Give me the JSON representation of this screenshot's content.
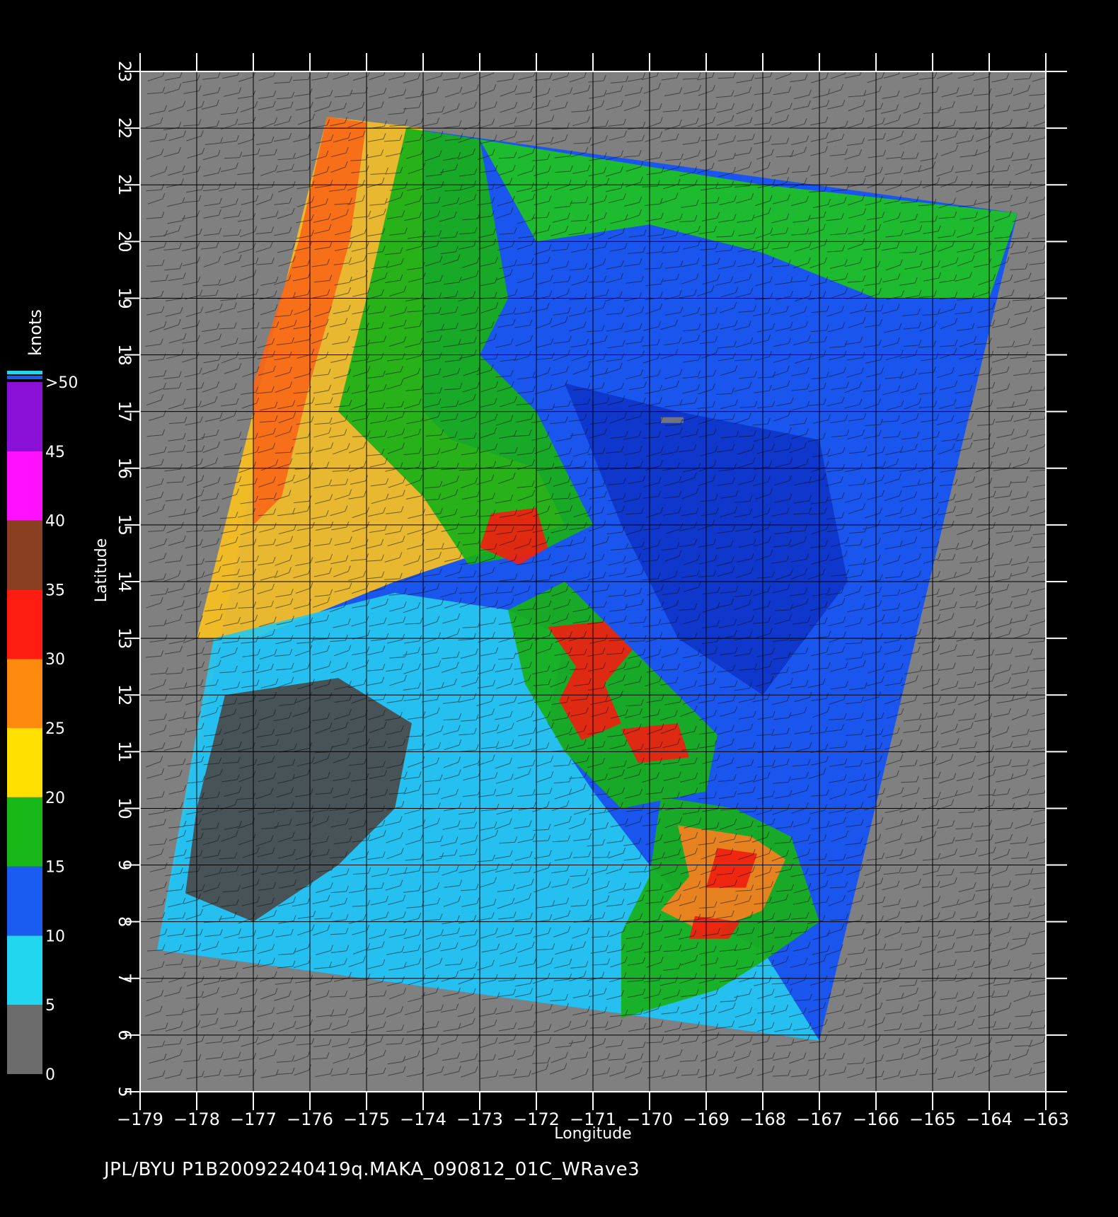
{
  "axes": {
    "xlabel": "Longitude",
    "ylabel": "Latitude",
    "x_ticks": [
      "−179",
      "−178",
      "−177",
      "−176",
      "−175",
      "−174",
      "−173",
      "−172",
      "−171",
      "−170",
      "−169",
      "−168",
      "−167",
      "−166",
      "−165",
      "−164",
      "−163"
    ],
    "y_ticks": [
      "5",
      "6",
      "7",
      "8",
      "9",
      "10",
      "11",
      "12",
      "13",
      "14",
      "15",
      "16",
      "17",
      "18",
      "19",
      "20",
      "21",
      "22",
      "23"
    ],
    "lon_range": [
      -179,
      -163
    ],
    "lat_range": [
      5,
      23
    ]
  },
  "colorbar": {
    "unit": "knots",
    "labels": [
      "0",
      "5",
      "10",
      "15",
      "20",
      "25",
      "30",
      "35",
      "40",
      "45",
      ">50"
    ],
    "bins": [
      {
        "from": 0,
        "to": 5,
        "color": "#6c6c6c"
      },
      {
        "from": 5,
        "to": 10,
        "color": "#22d6f0"
      },
      {
        "from": 10,
        "to": 15,
        "color": "#1a5cf2"
      },
      {
        "from": 15,
        "to": 20,
        "color": "#18b818"
      },
      {
        "from": 20,
        "to": 25,
        "color": "#ffe000"
      },
      {
        "from": 25,
        "to": 30,
        "color": "#ff8a10"
      },
      {
        "from": 30,
        "to": 35,
        "color": "#ff1c10"
      },
      {
        "from": 35,
        "to": 40,
        "color": "#8a4020"
      },
      {
        "from": 40,
        "to": 45,
        "color": "#ff10ff"
      },
      {
        "from": 45,
        "to": 50,
        "color": "#8a10d8"
      }
    ]
  },
  "swath": {
    "corners_lonlat": [
      [
        -175.7,
        22.2
      ],
      [
        -163.5,
        20.5
      ],
      [
        -167.0,
        5.9
      ],
      [
        -178.7,
        7.5
      ]
    ]
  },
  "regions": [
    {
      "speed_bin": "20-25",
      "color": "#f8c020",
      "polygon": [
        [
          -175.7,
          22.2
        ],
        [
          -174.0,
          22.0
        ],
        [
          -174.0,
          17.0
        ],
        [
          -173.5,
          16.5
        ],
        [
          -172.0,
          16.0
        ],
        [
          -171.5,
          15.0
        ],
        [
          -173.0,
          14.5
        ],
        [
          -174.5,
          14.0
        ],
        [
          -177.0,
          13.0
        ],
        [
          -178.0,
          13.0
        ]
      ]
    },
    {
      "speed_bin": "15-20",
      "color": "#18b018",
      "polygon": [
        [
          -174.3,
          22.0
        ],
        [
          -173.0,
          21.8
        ],
        [
          -172.5,
          19.0
        ],
        [
          -173.0,
          18.0
        ],
        [
          -172.0,
          17.0
        ],
        [
          -171.0,
          15.0
        ],
        [
          -172.0,
          14.5
        ],
        [
          -173.2,
          14.3
        ],
        [
          -174.0,
          15.5
        ],
        [
          -175.0,
          16.5
        ],
        [
          -175.5,
          17.0
        ],
        [
          -175.0,
          19.0
        ]
      ]
    },
    {
      "speed_bin": "15-20",
      "color": "#1ec21e",
      "polygon": [
        [
          -173.0,
          21.8
        ],
        [
          -168.0,
          21.0
        ],
        [
          -163.5,
          20.5
        ],
        [
          -164.0,
          19.0
        ],
        [
          -166.0,
          19.0
        ],
        [
          -168.0,
          19.8
        ],
        [
          -170.0,
          20.3
        ],
        [
          -172.0,
          20.0
        ]
      ]
    },
    {
      "speed_bin": "25-30",
      "color": "#f86818",
      "polygon": [
        [
          -175.7,
          22.2
        ],
        [
          -175.0,
          22.1
        ],
        [
          -175.3,
          20.0
        ],
        [
          -176.0,
          17.5
        ],
        [
          -176.5,
          15.5
        ],
        [
          -177.0,
          15.0
        ],
        [
          -177.0,
          17.5
        ],
        [
          -176.2,
          20.0
        ]
      ]
    },
    {
      "speed_bin": "5-10",
      "color": "#26c8f0",
      "polygon": [
        [
          -177.7,
          13.0
        ],
        [
          -174.5,
          13.8
        ],
        [
          -172.5,
          13.5
        ],
        [
          -171.5,
          13.0
        ],
        [
          -171.8,
          11.5
        ],
        [
          -171.0,
          10.3
        ],
        [
          -170.0,
          9.0
        ],
        [
          -169.0,
          8.0
        ],
        [
          -168.0,
          7.5
        ],
        [
          -167.0,
          5.9
        ],
        [
          -178.7,
          7.5
        ]
      ]
    },
    {
      "speed_bin": "0-5",
      "color": "#4a4a4a",
      "polygon": [
        [
          -177.5,
          12.0
        ],
        [
          -175.5,
          12.3
        ],
        [
          -174.2,
          11.5
        ],
        [
          -174.5,
          10.0
        ],
        [
          -175.5,
          9.0
        ],
        [
          -177.0,
          8.0
        ],
        [
          -178.2,
          8.5
        ],
        [
          -178.0,
          10.0
        ]
      ]
    },
    {
      "speed_bin": "15-20",
      "color": "#18b018",
      "polygon": [
        [
          -172.5,
          13.5
        ],
        [
          -171.5,
          14.0
        ],
        [
          -170.5,
          13.0
        ],
        [
          -169.5,
          12.0
        ],
        [
          -168.8,
          11.3
        ],
        [
          -169.0,
          10.3
        ],
        [
          -170.5,
          10.0
        ],
        [
          -171.5,
          11.0
        ],
        [
          -172.2,
          12.2
        ]
      ]
    },
    {
      "speed_bin": "30-35",
      "color": "#f02010",
      "polygon": [
        [
          -171.8,
          13.2
        ],
        [
          -170.8,
          13.3
        ],
        [
          -170.3,
          12.8
        ],
        [
          -170.8,
          12.2
        ],
        [
          -170.5,
          11.5
        ],
        [
          -171.2,
          11.2
        ],
        [
          -171.6,
          11.9
        ],
        [
          -171.3,
          12.5
        ]
      ]
    },
    {
      "speed_bin": "30-35",
      "color": "#f02010",
      "polygon": [
        [
          -172.8,
          15.2
        ],
        [
          -172.0,
          15.3
        ],
        [
          -171.8,
          14.6
        ],
        [
          -172.3,
          14.3
        ],
        [
          -173.0,
          14.6
        ]
      ]
    },
    {
      "speed_bin": "30-35",
      "color": "#f02010",
      "polygon": [
        [
          -170.5,
          11.4
        ],
        [
          -169.5,
          11.5
        ],
        [
          -169.3,
          10.9
        ],
        [
          -170.2,
          10.8
        ]
      ]
    },
    {
      "speed_bin": "15-20",
      "color": "#18b018",
      "polygon": [
        [
          -169.8,
          10.2
        ],
        [
          -168.5,
          10.0
        ],
        [
          -167.5,
          9.5
        ],
        [
          -167.0,
          8.0
        ],
        [
          -168.0,
          7.3
        ],
        [
          -168.8,
          6.8
        ],
        [
          -170.5,
          6.3
        ],
        [
          -170.5,
          7.8
        ],
        [
          -170.0,
          8.8
        ]
      ]
    },
    {
      "speed_bin": "25-30",
      "color": "#f88020",
      "polygon": [
        [
          -169.5,
          9.7
        ],
        [
          -168.2,
          9.5
        ],
        [
          -167.6,
          9.1
        ],
        [
          -168.0,
          8.2
        ],
        [
          -169.0,
          7.8
        ],
        [
          -169.8,
          8.2
        ],
        [
          -169.3,
          8.8
        ]
      ]
    },
    {
      "speed_bin": "30-35",
      "color": "#f02010",
      "polygon": [
        [
          -168.8,
          9.3
        ],
        [
          -168.1,
          9.2
        ],
        [
          -168.3,
          8.6
        ],
        [
          -169.0,
          8.6
        ]
      ]
    },
    {
      "speed_bin": "30-35",
      "color": "#f02010",
      "polygon": [
        [
          -169.2,
          8.1
        ],
        [
          -168.4,
          8.0
        ],
        [
          -168.6,
          7.7
        ],
        [
          -169.3,
          7.7
        ]
      ]
    },
    {
      "speed_bin": "10-15",
      "color": "#0e34c8",
      "polygon": [
        [
          -171.5,
          17.5
        ],
        [
          -169.5,
          17.0
        ],
        [
          -167.0,
          16.5
        ],
        [
          -166.5,
          14.0
        ],
        [
          -168.0,
          12.0
        ],
        [
          -169.5,
          13.0
        ],
        [
          -170.5,
          15.0
        ]
      ]
    },
    {
      "speed_bin": "0-5",
      "color": "#7a7a7a",
      "polygon": [
        [
          -169.8,
          16.9
        ],
        [
          -169.4,
          16.9
        ],
        [
          -169.4,
          16.8
        ],
        [
          -169.8,
          16.8
        ]
      ]
    }
  ],
  "footer": "JPL/BYU  P1B20092240419q.MAKA_090812_01C_WRave3"
}
